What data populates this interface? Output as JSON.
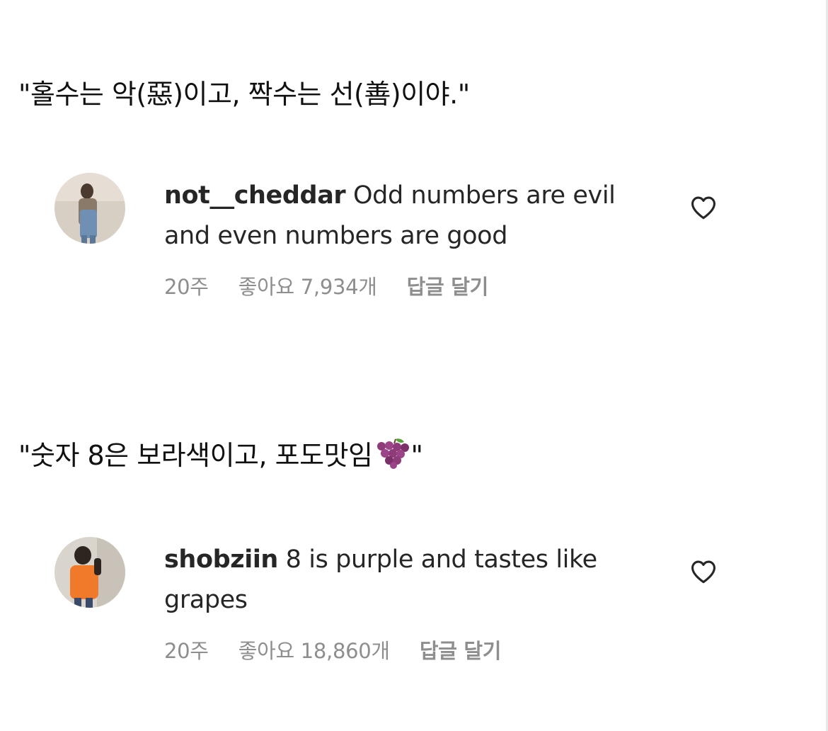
{
  "captions": {
    "first": "\"홀수는 악(惡)이고, 짝수는 선(善)이야.\"",
    "second_text": "\"숫자 8은 보라색이고, 포도맛임",
    "second_end": "\""
  },
  "comments": [
    {
      "username": "not__cheddar",
      "text": " Odd numbers are evil and even numbers are good",
      "time": "20주",
      "likes": "좋아요 7,934개",
      "reply": "답글 달기"
    },
    {
      "username": "shobziin",
      "text": " 8 is purple and tastes like grapes",
      "time": "20주",
      "likes": "좋아요 18,860개",
      "reply": "답글 달기"
    }
  ],
  "icons": {
    "heart": "heart-outline-icon",
    "grape": "grapes-emoji-icon"
  },
  "colors": {
    "text": "#262626",
    "meta": "#8e8e8e",
    "grape": "#8e3b7a"
  }
}
